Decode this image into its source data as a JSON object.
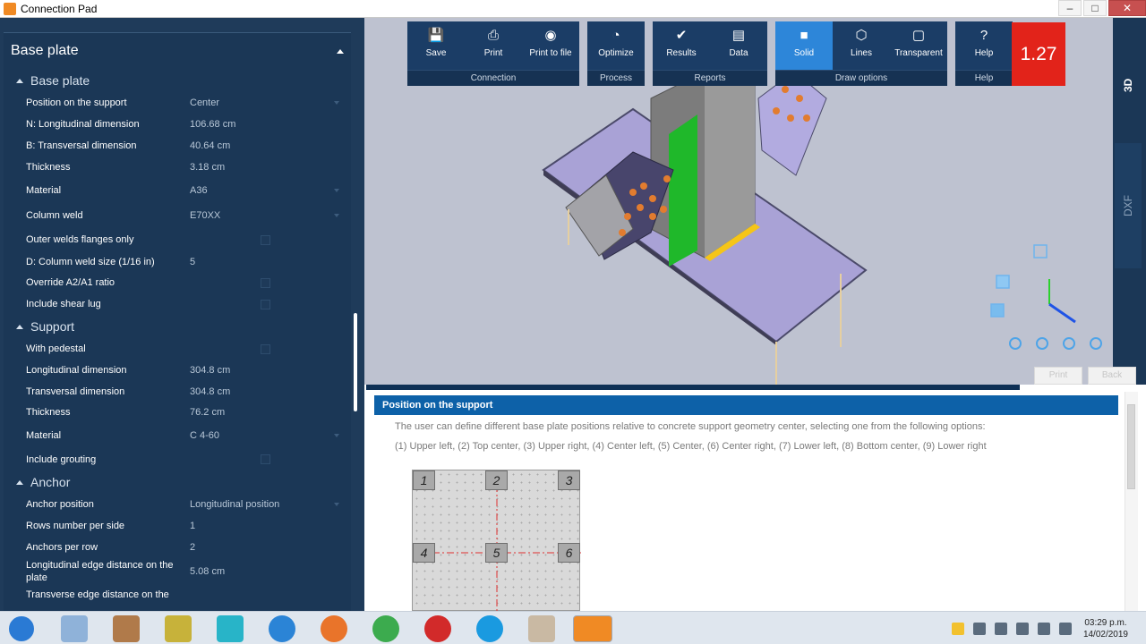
{
  "window": {
    "title": "Connection Pad",
    "controls": [
      "–",
      "□",
      "✕"
    ]
  },
  "panel": {
    "title": "Base plate",
    "sections": [
      {
        "title": "Base plate",
        "rows": [
          {
            "label": "Position on the support",
            "value": "Center",
            "type": "dropdown"
          },
          {
            "label": "N: Longitudinal dimension",
            "value": "106.68 cm",
            "type": "text"
          },
          {
            "label": "B: Transversal dimension",
            "value": "40.64 cm",
            "type": "text"
          },
          {
            "label": "Thickness",
            "value": "3.18 cm",
            "type": "text"
          },
          {
            "label": "Material",
            "value": "A36",
            "type": "dropdown"
          },
          {
            "label": "Column weld",
            "value": "E70XX",
            "type": "dropdown"
          },
          {
            "label": "Outer welds flanges only",
            "value": "",
            "type": "checkbox"
          },
          {
            "label": "D: Column weld size (1/16 in)",
            "value": "5",
            "type": "text"
          },
          {
            "label": "Override A2/A1 ratio",
            "value": "",
            "type": "checkbox"
          },
          {
            "label": "Include shear lug",
            "value": "",
            "type": "checkbox"
          }
        ]
      },
      {
        "title": "Support",
        "rows": [
          {
            "label": "With pedestal",
            "value": "",
            "type": "checkbox"
          },
          {
            "label": "Longitudinal dimension",
            "value": "304.8 cm",
            "type": "text"
          },
          {
            "label": "Transversal dimension",
            "value": "304.8 cm",
            "type": "text"
          },
          {
            "label": "Thickness",
            "value": "76.2 cm",
            "type": "text"
          },
          {
            "label": "Material",
            "value": "C 4-60",
            "type": "dropdown"
          },
          {
            "label": "Include grouting",
            "value": "",
            "type": "checkbox"
          }
        ]
      },
      {
        "title": "Anchor",
        "rows": [
          {
            "label": "Anchor position",
            "value": "Longitudinal position",
            "type": "dropdown"
          },
          {
            "label": "Rows number per side",
            "value": "1",
            "type": "text"
          },
          {
            "label": "Anchors per row",
            "value": "2",
            "type": "text"
          },
          {
            "label": "Longitudinal edge distance on the plate",
            "value": "5.08 cm",
            "type": "text"
          },
          {
            "label": "Transverse edge distance on the",
            "value": "",
            "type": "text"
          }
        ]
      }
    ]
  },
  "ribbon": {
    "groups": [
      {
        "label": "Connection",
        "buttons": [
          {
            "label": "Save",
            "icon": "save-icon"
          },
          {
            "label": "Print",
            "icon": "print-icon"
          },
          {
            "label": "Print to file",
            "icon": "camera-icon"
          }
        ]
      },
      {
        "label": "Process",
        "buttons": [
          {
            "label": "Optimize",
            "icon": "optimize-icon"
          }
        ]
      },
      {
        "label": "Reports",
        "buttons": [
          {
            "label": "Results",
            "icon": "results-icon"
          },
          {
            "label": "Data",
            "icon": "data-icon"
          }
        ]
      },
      {
        "label": "Draw options",
        "buttons": [
          {
            "label": "Solid",
            "icon": "solid-icon",
            "active": true
          },
          {
            "label": "Lines",
            "icon": "lines-icon"
          },
          {
            "label": "Transparent",
            "icon": "transparent-icon"
          }
        ]
      },
      {
        "label": "Help",
        "buttons": [
          {
            "label": "Help",
            "icon": "help-icon"
          }
        ]
      }
    ],
    "ratio": "1.27"
  },
  "view": {
    "side_tabs": [
      "3D",
      "DXF"
    ],
    "buttons": [
      "Print",
      "Back"
    ]
  },
  "help": {
    "heading": "Position on the support",
    "p1": "The user can define different base plate positions relative to concrete support geometry center, selecting one from the following options:",
    "p2": "(1) Upper left, (2) Top center, (3) Upper right, (4) Center left, (5) Center, (6) Center right, (7) Lower left, (8) Bottom center, (9) Lower right",
    "positions": [
      "1",
      "2",
      "3",
      "4",
      "5",
      "6"
    ]
  },
  "taskbar": {
    "time": "03:29 p.m.",
    "date": "14/02/2019"
  },
  "colors": {
    "panel_bg": "#1b3756",
    "ribbon_bg": "#1b3d66",
    "active_button": "#2d86d9",
    "ratio_bg": "#e2231a",
    "help_head": "#0d61a8"
  }
}
